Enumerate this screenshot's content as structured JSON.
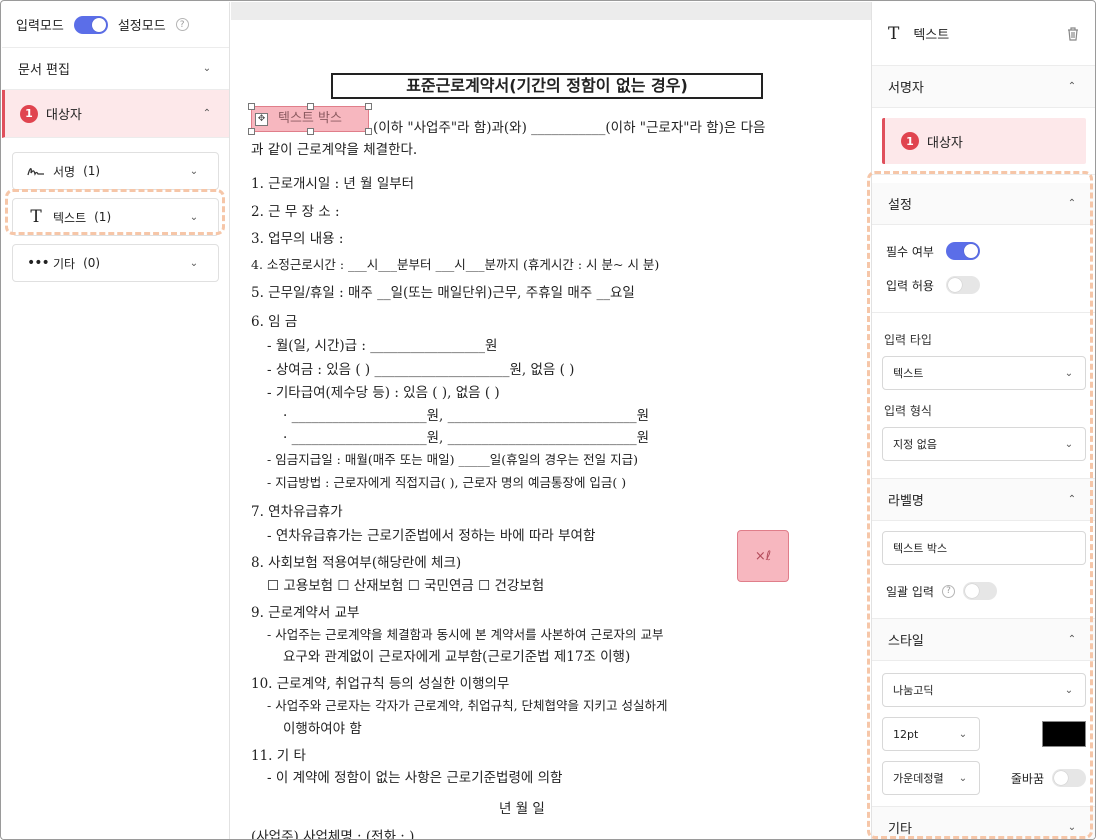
{
  "left_panel": {
    "input_mode_label": "입력모드",
    "setting_mode_label": "설정모드",
    "doc_edit_label": "문서 편집",
    "target": {
      "number": "1",
      "label": "대상자"
    },
    "fields": [
      {
        "icon": "signature-icon",
        "label": "서명",
        "count": "(1)"
      },
      {
        "icon": "text-icon",
        "label": "텍스트",
        "count": "(1)"
      },
      {
        "icon": "more-icon",
        "label": "기타",
        "count": "(0)"
      }
    ]
  },
  "document": {
    "title": "표준근로계약서(기간의 정함이 없는 경우)",
    "textbox_label": "텍스트 박스",
    "lines": [
      "(이하 \"사업주\"라 함)과(와) ___________(이하 \"근로자\"라 함)은 다음",
      "과 같이 근로계약을 체결한다.",
      "1. 근로개시일 :        년     월     일부터",
      "2. 근 무 장 소 :",
      "3. 업무의 내용 :",
      "4. 소정근로시간 : ___시___분부터 ___시___분까지 (휴게시간 :  시  분~  시   분)",
      "5. 근무일/휴일 : 매주 __일(또는 매일단위)근무, 주휴일 매주 __요일",
      "6. 임  금",
      "- 월(일, 시간)급 : _________________원",
      "- 상여금 : 있음 (     ) ____________________원,  없음 (      )",
      "- 기타급여(제수당 등) : 있음 (     ),   없음 (     )",
      "· ____________________원,   ____________________________원",
      "· ____________________원,   ____________________________원",
      "- 임금지급일 : 매월(매주 또는 매일)   _____일(휴일의 경우는 전일 지급)",
      "- 지급방법 : 근로자에게 직접지급(    ),  근로자 명의 예금통장에 입금(    )",
      "7. 연차유급휴가",
      "- 연차유급휴가는 근로기준법에서 정하는 바에 따라 부여함",
      "8. 사회보험 적용여부(해당란에 체크)",
      "☐ 고용보험  ☐ 산재보험  ☐ 국민연금  ☐ 건강보험",
      "9. 근로계약서 교부",
      "- 사업주는 근로계약을 체결함과 동시에 본 계약서를 사본하여 근로자의 교부",
      "요구와 관계없이 근로자에게 교부함(근로기준법 제17조 이행)",
      "10. 근로계약, 취업규칙 등의 성실한 이행의무",
      "- 사업주와 근로자는 각자가 근로계약, 취업규칙, 단체협약을 지키고 성실하게",
      "이행하여야 함",
      "11. 기   타",
      "- 이 계약에 정함이 없는 사항은 근로기준법령에 의함",
      "년        월        일",
      "(사업주) 사업체명 :                          (전화 :                )"
    ]
  },
  "right_panel": {
    "header_title": "텍스트",
    "signer_section": "서명자",
    "signer": {
      "number": "1",
      "label": "대상자"
    },
    "settings_section": "설정",
    "required_label": "필수 여부",
    "allow_input_label": "입력 허용",
    "input_type_label": "입력 타입",
    "input_type_value": "텍스트",
    "input_format_label": "입력 형식",
    "input_format_value": "지정 없음",
    "label_section": "라벨명",
    "label_value": "텍스트 박스",
    "batch_input_label": "일괄 입력",
    "style_section": "스타일",
    "font_value": "나눔고딕",
    "size_value": "12pt",
    "color": "#000000",
    "align_value": "가운데정렬",
    "wrap_label": "줄바꿈",
    "etc_section": "기타"
  }
}
